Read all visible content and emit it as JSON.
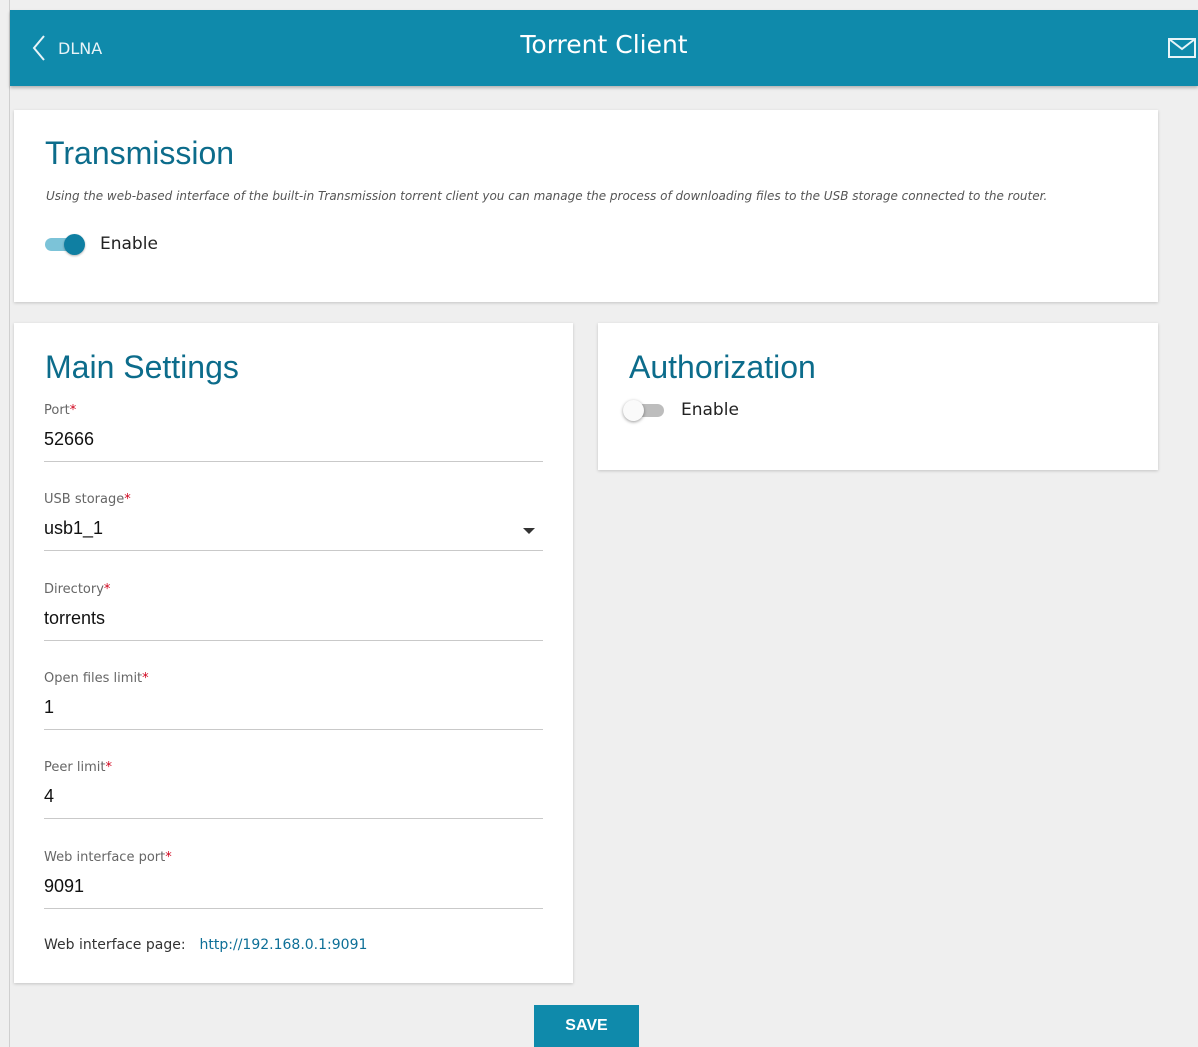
{
  "header": {
    "back_label": "DLNA",
    "title": "Torrent Client"
  },
  "transmission": {
    "title": "Transmission",
    "description": "Using the web-based interface of the built-in Transmission torrent client you can manage the process of downloading files to the USB storage connected to the router.",
    "enable_label": "Enable",
    "enabled": true
  },
  "main_settings": {
    "title": "Main Settings",
    "fields": {
      "port": {
        "label": "Port",
        "value": "52666"
      },
      "usb_storage": {
        "label": "USB storage",
        "value": "usb1_1"
      },
      "directory": {
        "label": "Directory",
        "value": "torrents"
      },
      "open_files_limit": {
        "label": "Open files limit",
        "value": "1"
      },
      "peer_limit": {
        "label": "Peer limit",
        "value": "4"
      },
      "web_interface_port": {
        "label": "Web interface port",
        "value": "9091"
      }
    },
    "required_mark": "*",
    "web_page_label": "Web interface page:",
    "web_page_link": "http://192.168.0.1:9091"
  },
  "authorization": {
    "title": "Authorization",
    "enable_label": "Enable",
    "enabled": false
  },
  "save_label": "SAVE",
  "colors": {
    "header": "#0f8aab",
    "title_text": "#0c6c8b",
    "required": "#d0021b",
    "link": "#0d6f97"
  }
}
